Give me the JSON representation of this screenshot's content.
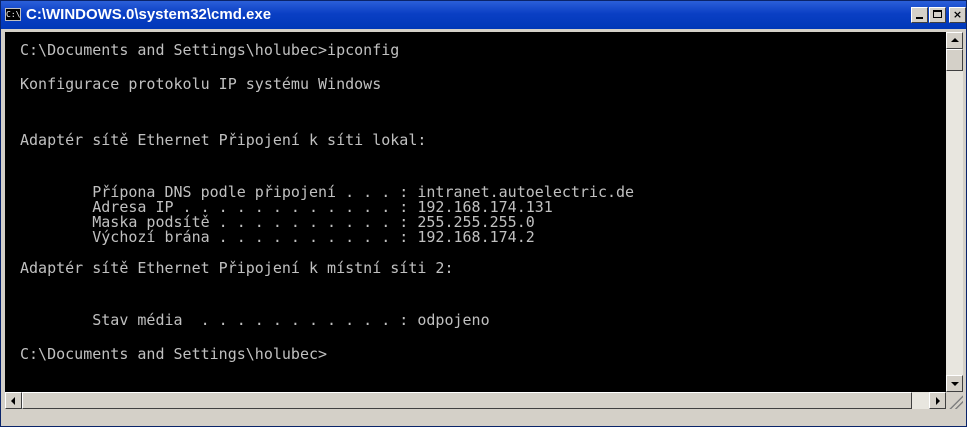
{
  "window": {
    "title": "C:\\WINDOWS.0\\system32\\cmd.exe",
    "app_icon": "C:\\",
    "controls": {
      "minimize": "_",
      "maximize": "□",
      "close": "×"
    }
  },
  "console": {
    "lines": [
      "C:\\Documents and Settings\\holubec>ipconfig",
      "Konfigurace protokolu IP systému Windows",
      "Adaptér sítě Ethernet Připojení k síti lokal:",
      "        Přípona DNS podle připojení . . . : intranet.autoelectric.de",
      "        Adresa IP . . . . . . . . . . . . : 192.168.174.131",
      "        Maska podsítě . . . . . . . . . . : 255.255.255.0",
      "        Výchozí brána . . . . . . . . . . : 192.168.174.2",
      "Adaptér sítě Ethernet Připojení k místní síti 2:",
      "        Stav média  . . . . . . . . . . . : odpojeno",
      "C:\\Documents and Settings\\holubec>"
    ]
  },
  "colors": {
    "titlebar": "#0a3fc4",
    "console_bg": "#000000",
    "console_text": "#c0c0c0"
  },
  "icons": {
    "app": "cmd-icon",
    "minimize": "minimize-icon",
    "maximize": "maximize-icon",
    "close": "close-icon",
    "scroll_up": "arrow-up-icon",
    "scroll_down": "arrow-down-icon",
    "scroll_left": "arrow-left-icon",
    "scroll_right": "arrow-right-icon"
  }
}
